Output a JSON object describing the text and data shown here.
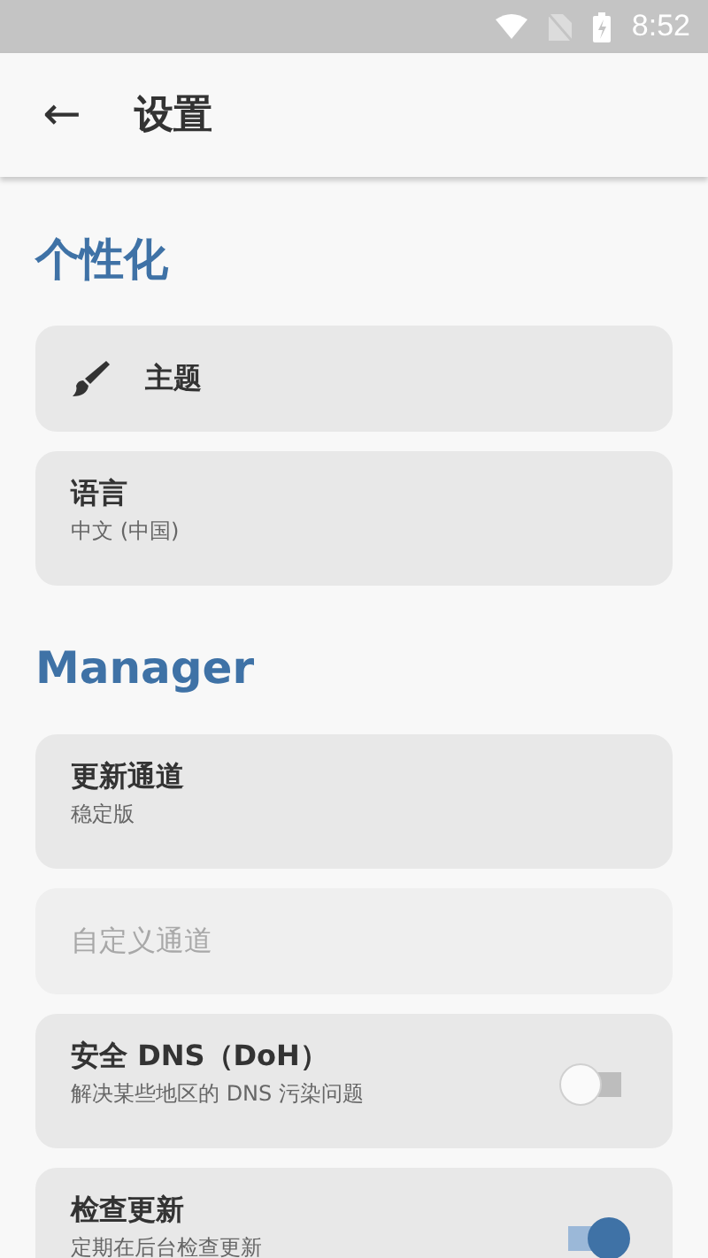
{
  "status_bar": {
    "time": "8:52"
  },
  "app_bar": {
    "back": "←",
    "title": "设置"
  },
  "sections": [
    {
      "title": "个性化",
      "items": [
        {
          "kind": "icon",
          "title": "主题",
          "disabled": false
        },
        {
          "kind": "text",
          "title": "语言",
          "subtitle": "中文 (中国)",
          "disabled": false
        }
      ]
    },
    {
      "title": "Manager",
      "items": [
        {
          "kind": "text",
          "title": "更新通道",
          "subtitle": "稳定版",
          "disabled": false
        },
        {
          "kind": "text",
          "title": "自定义通道",
          "disabled": true
        },
        {
          "kind": "switch",
          "title": "安全 DNS（DoH）",
          "subtitle": "解决某些地区的 DNS 污染问题",
          "on": false,
          "disabled": false
        },
        {
          "kind": "switch",
          "title": "检查更新",
          "subtitle": "定期在后台检查更新",
          "on": true,
          "disabled": false
        }
      ]
    }
  ]
}
